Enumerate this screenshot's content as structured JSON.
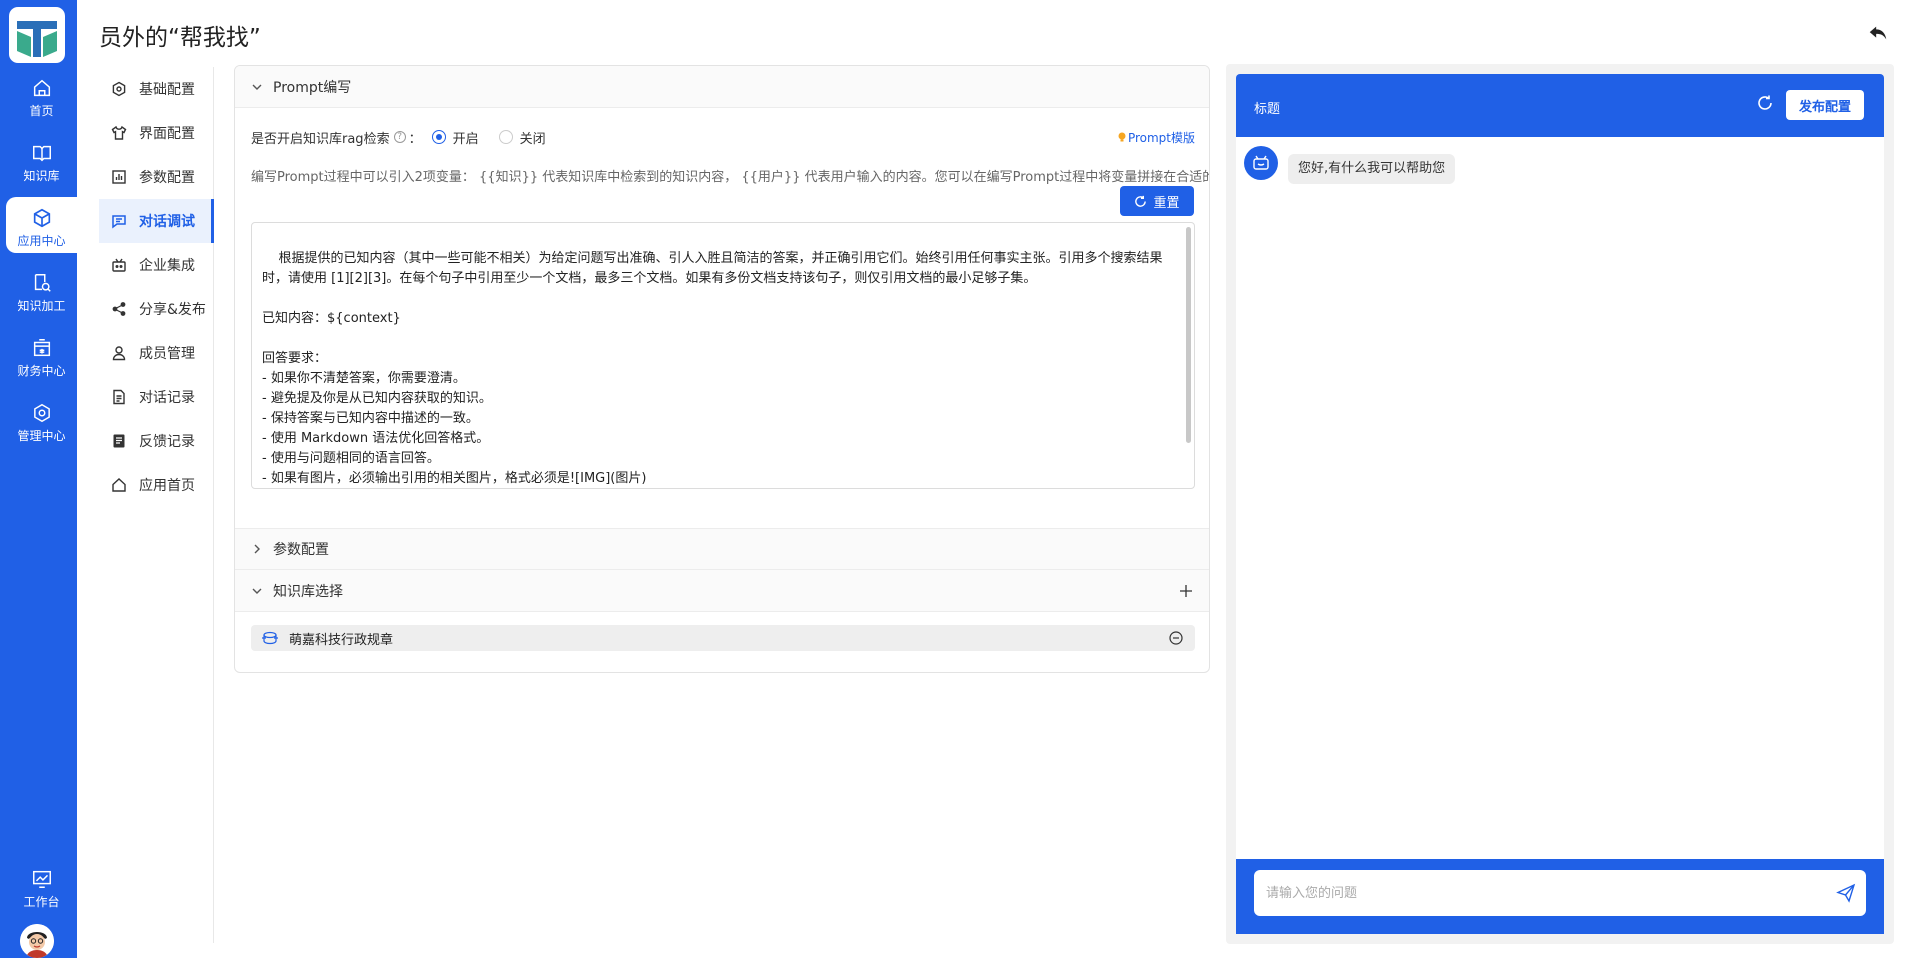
{
  "nav": {
    "items": [
      {
        "label": "首页",
        "icon": "home-icon"
      },
      {
        "label": "知识库",
        "icon": "book-icon"
      },
      {
        "label": "应用中心",
        "icon": "cube-icon"
      },
      {
        "label": "知识加工",
        "icon": "doc-search-icon"
      },
      {
        "label": "财务中心",
        "icon": "finance-icon"
      },
      {
        "label": "管理中心",
        "icon": "gear-icon"
      }
    ],
    "active": "应用中心",
    "workbench_label": "工作台"
  },
  "page": {
    "title": "员外的“帮我找”"
  },
  "menu": {
    "items": [
      {
        "label": "基础配置"
      },
      {
        "label": "界面配置"
      },
      {
        "label": "参数配置"
      },
      {
        "label": "对话调试"
      },
      {
        "label": "企业集成"
      },
      {
        "label": "分享&发布"
      },
      {
        "label": "成员管理"
      },
      {
        "label": "对话记录"
      },
      {
        "label": "反馈记录"
      },
      {
        "label": "应用首页"
      }
    ],
    "active": "对话调试"
  },
  "prompt_section": {
    "title": "Prompt编写",
    "rag_label": "是否开启知识库rag检索",
    "rag_colon": "：",
    "help_glyph": "?",
    "option_on": "开启",
    "option_off": "关闭",
    "rag_value": "开启",
    "template_link": "Prompt模版",
    "description": "编写Prompt过程中可以引入2项变量： {{知识}} 代表知识库中检索到的知识内容， {{用户}} 代表用户输入的内容。您可以在编写Prompt过程中将变量拼接在合适的位置。",
    "reset_label": "重置",
    "prompt_text": "根据提供的已知内容（其中一些可能不相关）为给定问题写出准确、引人入胜且简洁的答案，并正确引用它们。始终引用任何事实主张。引用多个搜索结果时，请使用 [1][2][3]。在每个句子中引用至少一个文档，最多三个文档。如果有多份文档支持该句子，则仅引用文档的最小足够子集。\n\n已知内容：${context}\n\n回答要求：\n- 如果你不清楚答案，你需要澄清。\n- 避免提及你是从已知内容获取的知识。\n- 保持答案与已知内容中描述的一致。\n- 使用 Markdown 语法优化回答格式。\n- 使用与问题相同的语言回答。\n- 如果有图片，必须输出引用的相关图片，格式必须是![IMG](图片)"
  },
  "param_section": {
    "title": "参数配置"
  },
  "kb_section": {
    "title": "知识库选择",
    "items": [
      {
        "name": "萌嘉科技行政规章"
      }
    ]
  },
  "chat": {
    "title": "标题",
    "publish_label": "发布配置",
    "greeting": "您好,有什么我可以帮助您",
    "input_placeholder": "请输入您的问题"
  },
  "colors": {
    "primary": "#2060e6",
    "panel_bg": "#f2f2f2"
  }
}
